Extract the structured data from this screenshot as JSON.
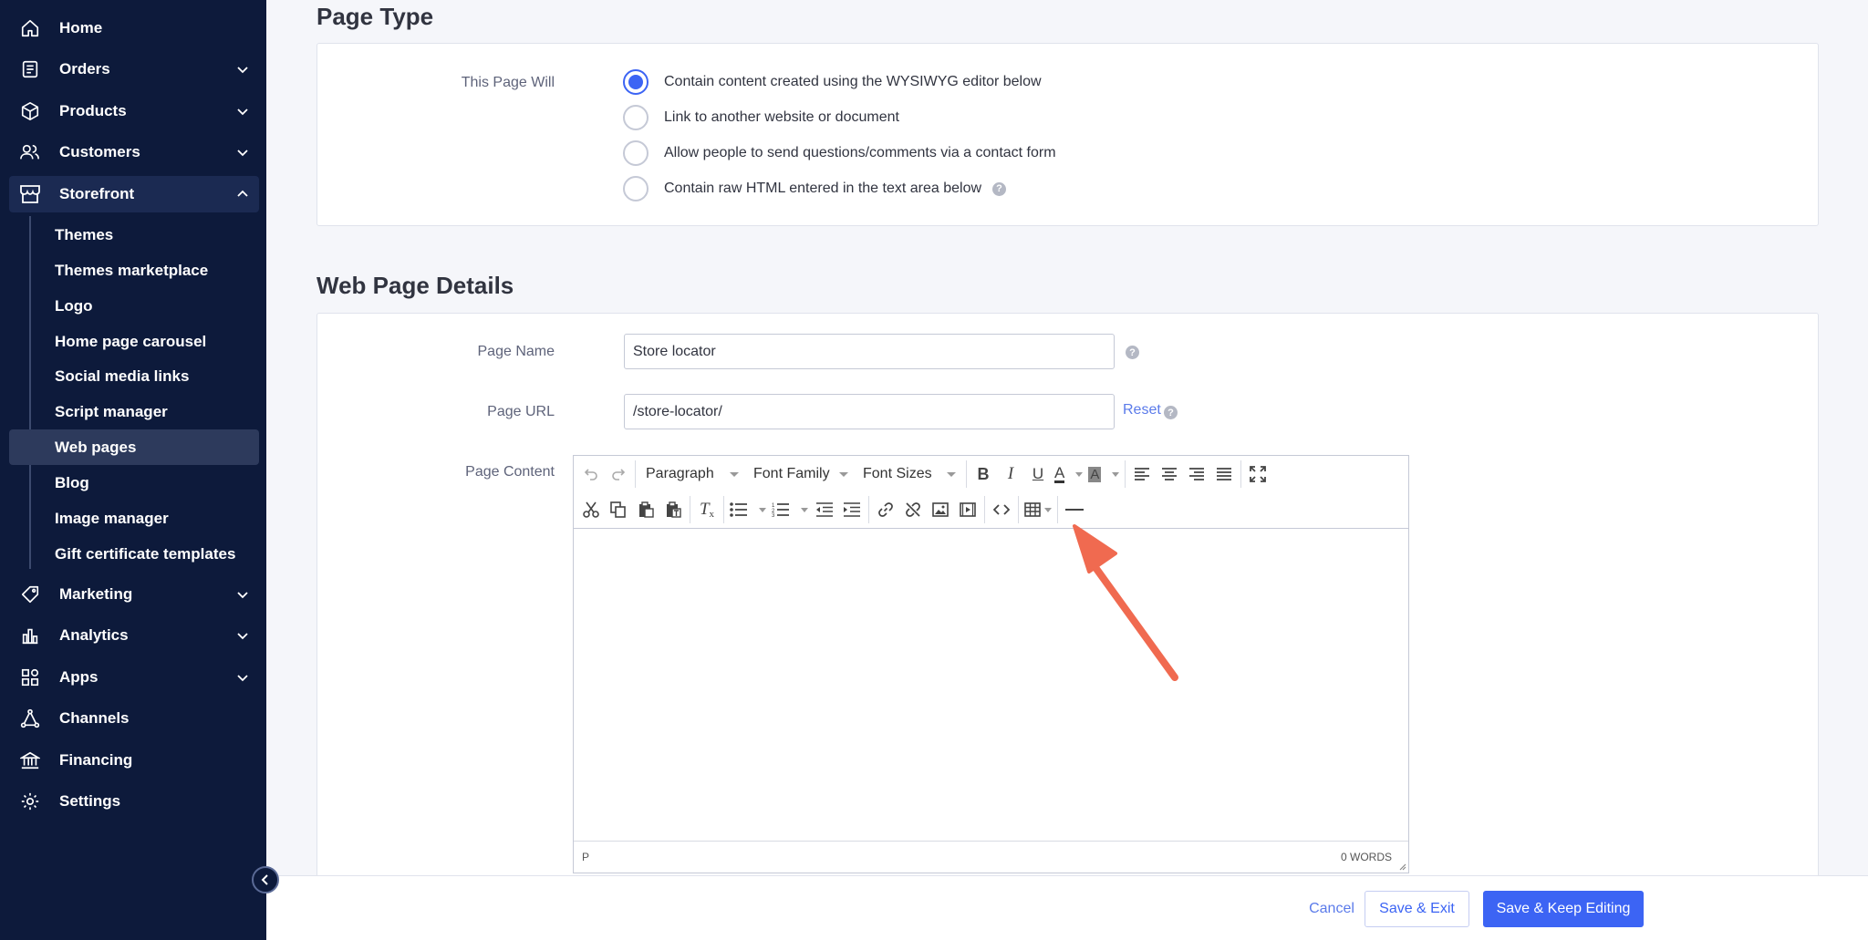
{
  "sidebar": {
    "nav_top": [
      {
        "label": "Home",
        "icon": "home-icon",
        "chevron": false
      },
      {
        "label": "Orders",
        "icon": "orders-icon",
        "chevron": true
      },
      {
        "label": "Products",
        "icon": "products-icon",
        "chevron": true
      },
      {
        "label": "Customers",
        "icon": "customers-icon",
        "chevron": true
      },
      {
        "label": "Storefront",
        "icon": "storefront-icon",
        "chevron": true,
        "expanded": true
      }
    ],
    "storefront_items": [
      "Themes",
      "Themes marketplace",
      "Logo",
      "Home page carousel",
      "Social media links",
      "Script manager",
      "Web pages",
      "Blog",
      "Image manager",
      "Gift certificate templates"
    ],
    "active_subitem": "Web pages",
    "nav_bottom": [
      {
        "label": "Marketing",
        "icon": "marketing-icon",
        "chevron": true
      },
      {
        "label": "Analytics",
        "icon": "analytics-icon",
        "chevron": true
      },
      {
        "label": "Apps",
        "icon": "apps-icon",
        "chevron": true
      },
      {
        "label": "Channels",
        "icon": "channels-icon",
        "chevron": false
      },
      {
        "label": "Financing",
        "icon": "financing-icon",
        "chevron": false
      },
      {
        "label": "Settings",
        "icon": "settings-icon",
        "chevron": false
      }
    ]
  },
  "page_type": {
    "title": "Page Type",
    "label": "This Page Will",
    "options": [
      "Contain content created using the WYSIWYG editor below",
      "Link to another website or document",
      "Allow people to send questions/comments via a contact form",
      "Contain raw HTML entered in the text area below"
    ],
    "selected_index": 0
  },
  "web_page_details": {
    "title": "Web Page Details",
    "page_name_label": "Page Name",
    "page_name_value": "Store locator",
    "page_url_label": "Page URL",
    "page_url_value": "/store-locator/",
    "reset_label": "Reset",
    "page_content_label": "Page Content"
  },
  "editor": {
    "format_select": "Paragraph",
    "font_family_select": "Font Family",
    "font_sizes_select": "Font Sizes",
    "status_path": "P",
    "word_count": "0 WORDS"
  },
  "footer": {
    "cancel_label": "Cancel",
    "save_exit_label": "Save & Exit",
    "save_keep_label": "Save & Keep Editing"
  },
  "colors": {
    "sidebar_bg": "#0d1a3b",
    "accent": "#3c64f4",
    "link": "#5b7bea",
    "annotation_arrow": "#f06a50"
  }
}
